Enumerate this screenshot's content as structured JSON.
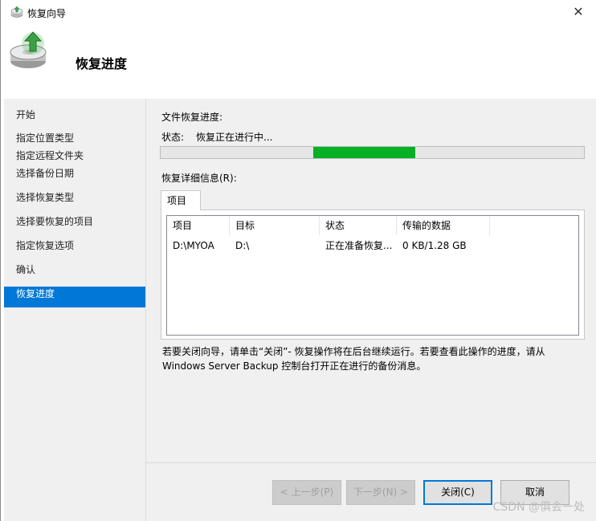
{
  "window": {
    "title": "恢复向导",
    "close_glyph": "✕"
  },
  "header": {
    "title": "恢复进度",
    "icon": "restore-disk-icon"
  },
  "sidebar": {
    "items": [
      {
        "label": "开始"
      },
      {
        "label": "指定位置类型"
      },
      {
        "label": "指定远程文件夹"
      },
      {
        "label": "选择备份日期"
      },
      {
        "label": "选择恢复类型"
      },
      {
        "label": "选择要恢复的项目"
      },
      {
        "label": "指定恢复选项"
      },
      {
        "label": "确认"
      },
      {
        "label": "恢复进度",
        "active": true
      }
    ]
  },
  "main": {
    "progress_label": "文件恢复进度:",
    "status_label": "状态:",
    "status_value": "恢复正在进行中...",
    "progress_fraction": 0.24,
    "details_label": "恢复详细信息(R):",
    "tab_label": "项目",
    "columns": [
      "项目",
      "目标",
      "状态",
      "传输的数据"
    ],
    "rows": [
      [
        "D:\\MYOA",
        "D:\\",
        "正在准备恢复...",
        "0 KB/1.28 GB"
      ]
    ],
    "note_line1": "若要关闭向导，请单击“关闭”- 恢复操作将在后台继续运行。若要查看此操作的进度，请从",
    "note_line2": "Windows Server Backup 控制台打开正在进行的备份消息。"
  },
  "buttons": {
    "prev": "< 上一步(P)",
    "next": "下一步(N) >",
    "close": "关闭(C)",
    "cancel": "取消"
  },
  "watermark": "CSDN @俱会一处",
  "colors": {
    "accent": "#0078d7",
    "progress": "#06b025",
    "panel_bg": "#f0f0f0"
  }
}
